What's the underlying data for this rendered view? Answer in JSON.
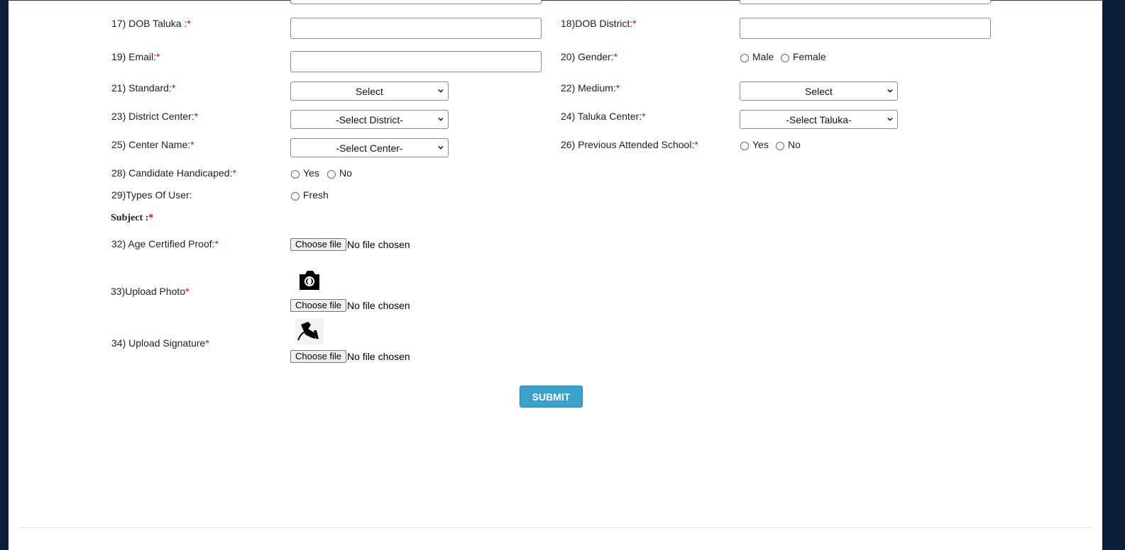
{
  "form": {
    "required_mark": "*",
    "dob_taluka": {
      "label": "17) DOB Taluka :",
      "value": ""
    },
    "dob_district": {
      "label": "18)DOB District:",
      "value": ""
    },
    "email": {
      "label": "19) Email:",
      "value": ""
    },
    "gender": {
      "label": "20) Gender:",
      "options": [
        "Male",
        "Female"
      ]
    },
    "standard": {
      "label": "21) Standard:",
      "selected": "Select"
    },
    "medium": {
      "label": "22) Medium:",
      "selected": "Select"
    },
    "district_center": {
      "label": "23) District Center:",
      "selected": "-Select District-"
    },
    "taluka_center": {
      "label": "24) Taluka Center:",
      "selected": "-Select Taluka-"
    },
    "center_name": {
      "label": "25) Center Name:",
      "selected": "-Select Center-"
    },
    "previous_school": {
      "label": "26) Previous Attended School:",
      "options": [
        "Yes",
        "No"
      ]
    },
    "handicaped": {
      "label": "28) Candidate Handicaped:",
      "options": [
        "Yes",
        "No"
      ]
    },
    "user_type": {
      "label": "29)Types Of User:",
      "options": [
        "Fresh"
      ]
    },
    "subject": {
      "label": "Subject :"
    },
    "age_proof": {
      "label": "32) Age Certified Proof:",
      "button": "Choose file",
      "status": "No file chosen"
    },
    "photo": {
      "label": "33)Upload Photo",
      "button": "Choose file",
      "status": "No file chosen"
    },
    "signature": {
      "label": "34) Upload Signature",
      "button": "Choose file",
      "status": "No file chosen"
    },
    "submit_label": "SUBMIT"
  },
  "icons": {
    "photo": "camera-icon",
    "signature": "signature-icon"
  },
  "colors": {
    "required": "#e00000",
    "submit_bg": "#3aa3cc",
    "frame": "#0c1e3a"
  }
}
